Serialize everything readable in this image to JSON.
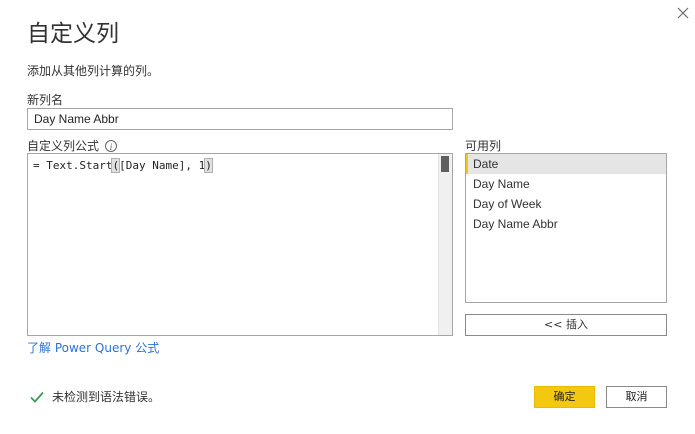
{
  "dialog": {
    "title": "自定义列",
    "subtitle": "添加从其他列计算的列。"
  },
  "new_column": {
    "label": "新列名",
    "value": "Day Name Abbr"
  },
  "formula": {
    "label": "自定义列公式",
    "code_prefix": "= Text.Start",
    "code_open_paren": "(",
    "code_middle": "[Day Name], 1",
    "code_close_paren": ")"
  },
  "available_columns": {
    "label": "可用列",
    "items": [
      "Date",
      "Day Name",
      "Day of Week",
      "Day Name Abbr"
    ],
    "selected": "Date",
    "insert_label": "<< 插入"
  },
  "learn_link": "了解 Power Query 公式",
  "status": {
    "message": "未检测到语法错误。",
    "icon": "checkmark-icon",
    "color": "#3a9b52"
  },
  "buttons": {
    "ok": "确定",
    "cancel": "取消"
  },
  "colors": {
    "accent": "#f2c811",
    "link": "#2b73d6"
  }
}
